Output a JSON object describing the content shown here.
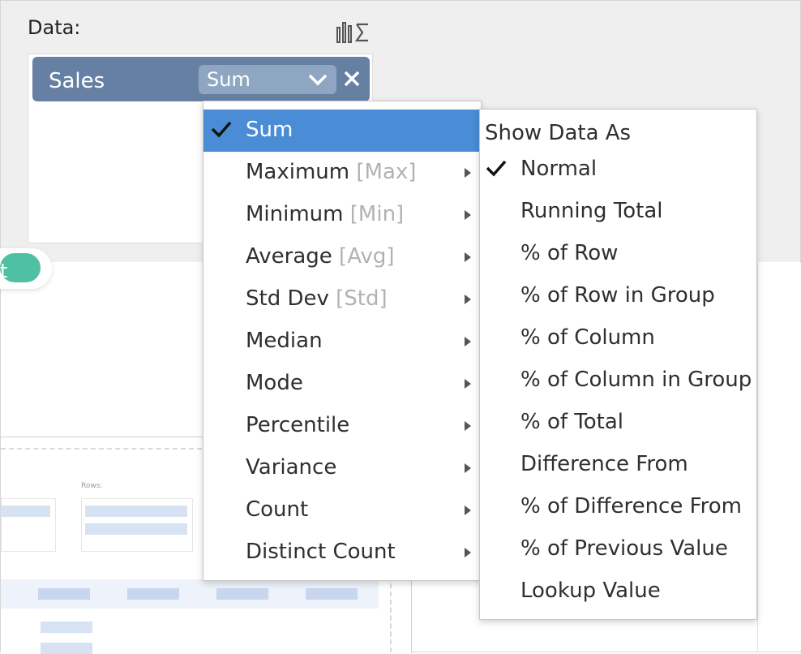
{
  "data_section": {
    "label": "Data:",
    "summary_icon": "bar-sigma-icon"
  },
  "field": {
    "name": "Sales",
    "aggregation": "Sum",
    "dropdown_icon": "chevron-down-icon",
    "remove_icon": "close-icon"
  },
  "tag_pill": {
    "text": "t"
  },
  "mini_preview": {
    "rows_label": "Rows:"
  },
  "aggregation_menu": {
    "items": [
      {
        "label": "Sum",
        "abbr": "",
        "selected": true
      },
      {
        "label": "Maximum",
        "abbr": "[Max]",
        "selected": false
      },
      {
        "label": "Minimum",
        "abbr": "[Min]",
        "selected": false
      },
      {
        "label": "Average",
        "abbr": "[Avg]",
        "selected": false
      },
      {
        "label": "Std Dev",
        "abbr": "[Std]",
        "selected": false
      },
      {
        "label": "Median",
        "abbr": "",
        "selected": false
      },
      {
        "label": "Mode",
        "abbr": "",
        "selected": false
      },
      {
        "label": "Percentile",
        "abbr": "",
        "selected": false
      },
      {
        "label": "Variance",
        "abbr": "",
        "selected": false
      },
      {
        "label": "Count",
        "abbr": "",
        "selected": false
      },
      {
        "label": "Distinct Count",
        "abbr": "",
        "selected": false
      }
    ]
  },
  "show_data_menu": {
    "heading": "Show Data As",
    "items": [
      {
        "label": "Normal",
        "checked": true
      },
      {
        "label": "Running Total",
        "checked": false
      },
      {
        "label": "% of Row",
        "checked": false
      },
      {
        "label": "% of Row in Group",
        "checked": false
      },
      {
        "label": "% of Column",
        "checked": false
      },
      {
        "label": "% of Column in Group",
        "checked": false
      },
      {
        "label": "% of Total",
        "checked": false
      },
      {
        "label": "Difference From",
        "checked": false
      },
      {
        "label": "% of Difference From",
        "checked": false
      },
      {
        "label": "% of Previous Value",
        "checked": false
      },
      {
        "label": "Lookup Value",
        "checked": false
      }
    ]
  },
  "colors": {
    "field_pill": "#6680a3",
    "selected_item": "#4a8cd6",
    "teal_accent": "#4fc0a4"
  }
}
